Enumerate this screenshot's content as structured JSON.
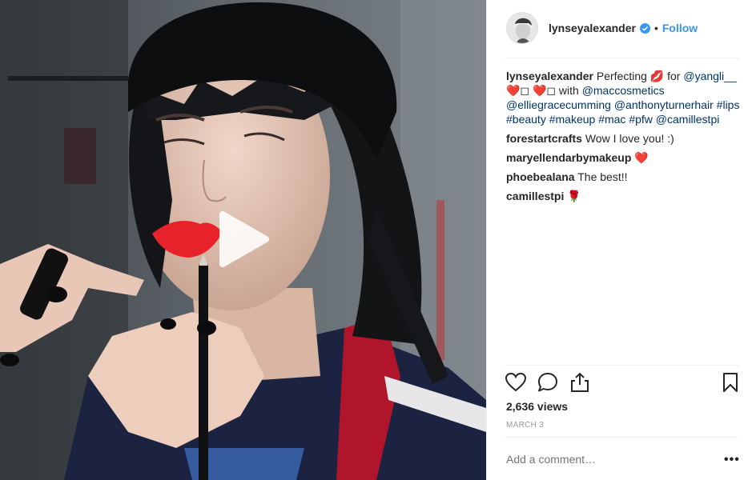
{
  "post": {
    "author": "lynseyalexander",
    "follow_label": "Follow",
    "separator": "•"
  },
  "caption": {
    "username": "lynseyalexander",
    "text_1": " Perfecting ",
    "emoji_kiss": "💋",
    "text_2": " for ",
    "mention_1": "@yangli__",
    "emoji_hearts": " ❤️◻ ❤️◻ ",
    "text_3": "with ",
    "mention_2": "@maccosmetics",
    "mention_3": "@elliegracecumming",
    "mention_4": "@anthonyturnerhair",
    "tags": "#lips #beauty #makeup #mac #pfw",
    "mention_5": "@camillestpi"
  },
  "comments": [
    {
      "user": "forestartcrafts",
      "text": " Wow I love you! :)"
    },
    {
      "user": "maryellendarbymakeup",
      "text": " ❤️"
    },
    {
      "user": "phoebealana",
      "text": " The best!!"
    },
    {
      "user": "camillestpi",
      "text": " 🌹"
    }
  ],
  "stats": {
    "views": "2,636 views",
    "date": "MARCH 3"
  },
  "composer": {
    "placeholder": "Add a comment…",
    "more_label": "•••"
  },
  "icons": {
    "like": "heart-icon",
    "comment": "comment-bubble-icon",
    "share": "share-icon",
    "save": "bookmark-icon",
    "play": "play-icon",
    "verified": "verified-badge-icon"
  },
  "colors": {
    "link": "#3897f0",
    "mention": "#003569",
    "muted": "#999999",
    "lipstick": "#e8222a"
  }
}
